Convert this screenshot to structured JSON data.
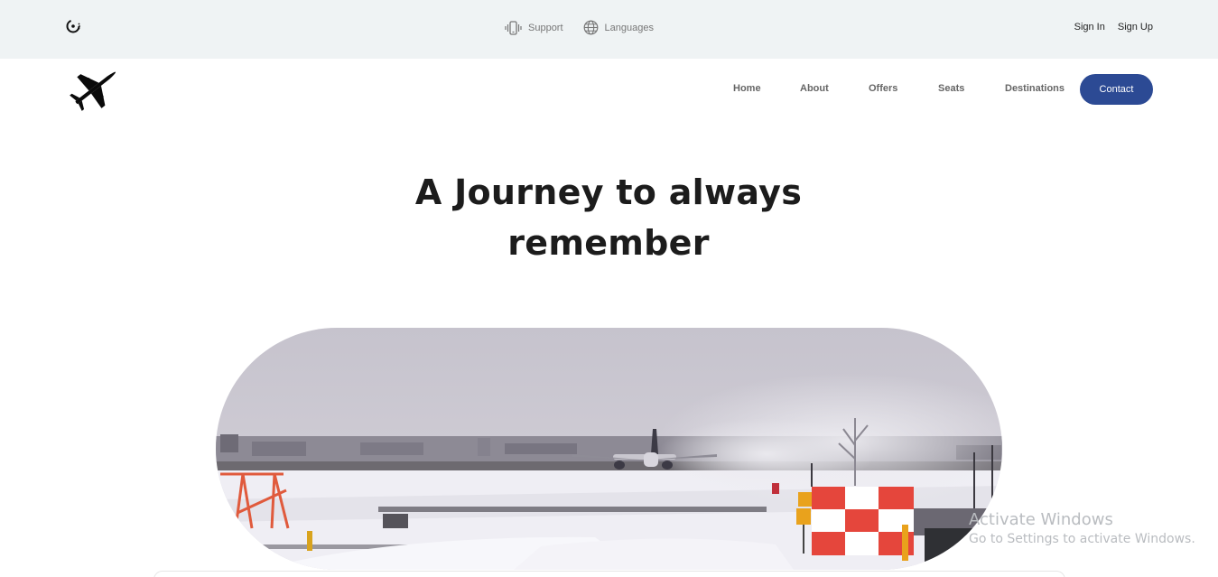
{
  "topbar": {
    "logo_icon": "spinner-logo-icon",
    "support_label": "Support",
    "support_icon": "phone-vibrate-icon",
    "languages_label": "Languages",
    "languages_icon": "globe-icon",
    "sign_in_label": "Sign In",
    "sign_up_label": "Sign Up"
  },
  "navbar": {
    "brand_icon": "airplane-logo-icon",
    "links": [
      "Home",
      "About",
      "Offers",
      "Seats",
      "Destinations"
    ],
    "contact_label": "Contact",
    "contact_color": "#2c4a94"
  },
  "hero": {
    "title_line1": "A Journey to always",
    "title_line2": "remember",
    "image_description_icon": "airport-runway-photo"
  },
  "watermark": {
    "title": "Activate Windows",
    "subtitle": "Go to Settings to activate Windows."
  }
}
